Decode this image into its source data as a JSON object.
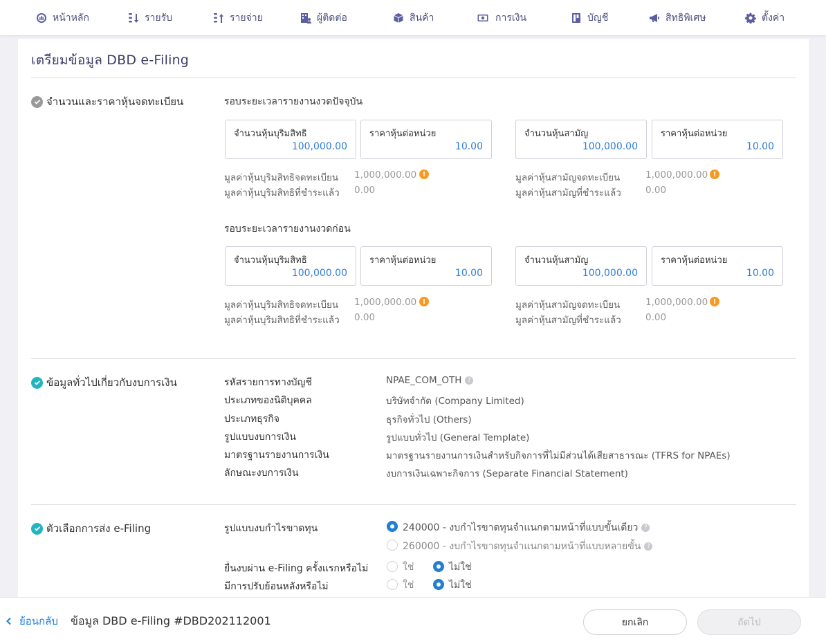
{
  "nav": [
    {
      "label": "หน้าหลัก",
      "icon": "dashboard-icon"
    },
    {
      "label": "รายรับ",
      "icon": "income-icon"
    },
    {
      "label": "รายจ่าย",
      "icon": "expense-icon"
    },
    {
      "label": "ผู้ติดต่อ",
      "icon": "contacts-icon"
    },
    {
      "label": "สินค้า",
      "icon": "product-box-icon"
    },
    {
      "label": "การเงิน",
      "icon": "money-icon"
    },
    {
      "label": "บัญชี",
      "icon": "ledger-icon"
    },
    {
      "label": "สิทธิพิเศษ",
      "icon": "megaphone-icon"
    },
    {
      "label": "ตั้งค่า",
      "icon": "gear-icon"
    }
  ],
  "page": {
    "title": "เตรียมข้อมูล DBD e-Filing"
  },
  "shares": {
    "section_title": "จำนวนและราคาหุ้นจดทะเบียน",
    "periods": [
      {
        "heading": "รอบระยะเวลารายงานงวดปัจจุบัน",
        "preferred": {
          "count_label": "จำนวนหุ้นบุริมสิทธิ",
          "count_value": "100,000.00",
          "price_label": "ราคาหุ้นต่อหน่วย",
          "price_value": "10.00",
          "registered_label": "มูลค่าหุ้นบุริมสิทธิจดทะเบียน",
          "registered_value": "1,000,000.00",
          "paid_label": "มูลค่าหุ้นบุริมสิทธิที่ชำระแล้ว",
          "paid_value": "0.00"
        },
        "common": {
          "count_label": "จำนวนหุ้นสามัญ",
          "count_value": "100,000.00",
          "price_label": "ราคาหุ้นต่อหน่วย",
          "price_value": "10.00",
          "registered_label": "มูลค่าหุ้นสามัญจดทะเบียน",
          "registered_value": "1,000,000.00",
          "paid_label": "มูลค่าหุ้นสามัญที่ชำระแล้ว",
          "paid_value": "0.00"
        }
      },
      {
        "heading": "รอบระยะเวลารายงานงวดก่อน",
        "preferred": {
          "count_label": "จำนวนหุ้นบุริมสิทธิ",
          "count_value": "100,000.00",
          "price_label": "ราคาหุ้นต่อหน่วย",
          "price_value": "10.00",
          "registered_label": "มูลค่าหุ้นบุริมสิทธิจดทะเบียน",
          "registered_value": "1,000,000.00",
          "paid_label": "มูลค่าหุ้นบุริมสิทธิที่ชำระแล้ว",
          "paid_value": "0.00"
        },
        "common": {
          "count_label": "จำนวนหุ้นสามัญ",
          "count_value": "100,000.00",
          "price_label": "ราคาหุ้นต่อหน่วย",
          "price_value": "10.00",
          "registered_label": "มูลค่าหุ้นสามัญจดทะเบียน",
          "registered_value": "1,000,000.00",
          "paid_label": "มูลค่าหุ้นสามัญที่ชำระแล้ว",
          "paid_value": "0.00"
        }
      }
    ]
  },
  "general": {
    "section_title": "ข้อมูลทั่วไปเกี่ยวกับงบการเงิน",
    "rows": [
      {
        "label": "รหัสรายการทางบัญชี",
        "value": "NPAE_COM_OTH"
      },
      {
        "label": "ประเภทของนิติบุคคล",
        "value": "บริษัทจำกัด (Company Limited)"
      },
      {
        "label": "ประเภทธุรกิจ",
        "value": "ธุรกิจทั่วไป (Others)"
      },
      {
        "label": "รูปแบบงบการเงิน",
        "value": "รูปแบบทั่วไป (General Template)"
      },
      {
        "label": "มาตรฐานรายงานการเงิน",
        "value": "มาตรฐานรายงานการเงินสำหรับกิจการที่ไม่มีส่วนได้เสียสาธารณะ (TFRS for NPAEs)"
      },
      {
        "label": "ลักษณะงบการเงิน",
        "value": "งบการเงินเฉพาะกิจการ (Separate Financial Statement)"
      }
    ]
  },
  "efiling": {
    "section_title": "ตัวเลือกการส่ง e-Filing",
    "pl_label": "รูปแบบงบกำไรขาดทุน",
    "pl_options": [
      {
        "label": "240000 - งบกำไรขาดทุนจำแนกตามหน้าที่แบบขั้นเดียว",
        "selected": true
      },
      {
        "label": "260000 - งบกำไรขาดทุนจำแนกตามหน้าที่แบบหลายขั้น",
        "selected": false
      }
    ],
    "first_time_label": "ยื่นงบผ่าน e-Filing ครั้งแรกหรือไม่",
    "restated_label": "มีการปรับย้อนหลังหรือไม่",
    "yes": "ใช่",
    "no": "ไม่ใช่",
    "first_time_answer": "no",
    "restated_answer": "no"
  },
  "footer": {
    "back_label": "ย้อนกลับ",
    "doc_title": "ข้อมูล DBD e-Filing #DBD202112001",
    "cancel_label": "ยกเลิก",
    "next_label": "ถัดไป"
  },
  "colors": {
    "accent": "#1e7fd6",
    "value_blue": "#2f7dd9",
    "warning": "#f59a22",
    "check_teal": "#23b4c1",
    "nav_text": "#4a4f7a"
  }
}
